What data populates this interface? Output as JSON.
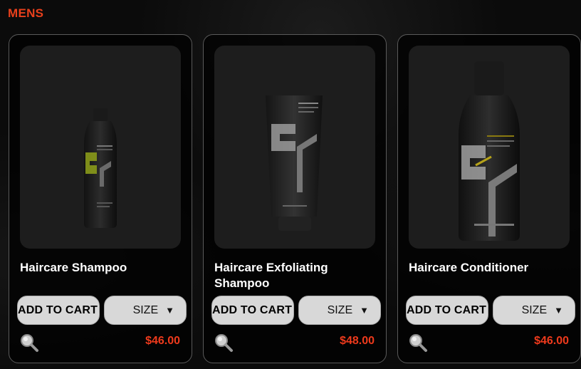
{
  "section": {
    "title": "MENS"
  },
  "colors": {
    "accent": "#e8401c",
    "price": "#ef3a1c",
    "card_border": "#5a5a5a",
    "button": "#d8d8d8"
  },
  "products": [
    {
      "name": "Haircare Shampoo",
      "add_to_cart": "ADD TO CART",
      "size_label": "SIZE",
      "size_caret": "▼",
      "price": "$46.00",
      "zoom_icon": "magnifier-icon",
      "image": "bottle-shampoo"
    },
    {
      "name": "Haircare Exfoliating Shampoo",
      "add_to_cart": "ADD TO CART",
      "size_label": "SIZE",
      "size_caret": "▼",
      "price": "$48.00",
      "zoom_icon": "magnifier-icon",
      "image": "tube-exfoliating-shampoo"
    },
    {
      "name": "Haircare Conditioner",
      "add_to_cart": "ADD TO CART",
      "size_label": "SIZE",
      "size_caret": "▼",
      "price": "$46.00",
      "zoom_icon": "magnifier-icon",
      "image": "bottle-conditioner"
    }
  ]
}
